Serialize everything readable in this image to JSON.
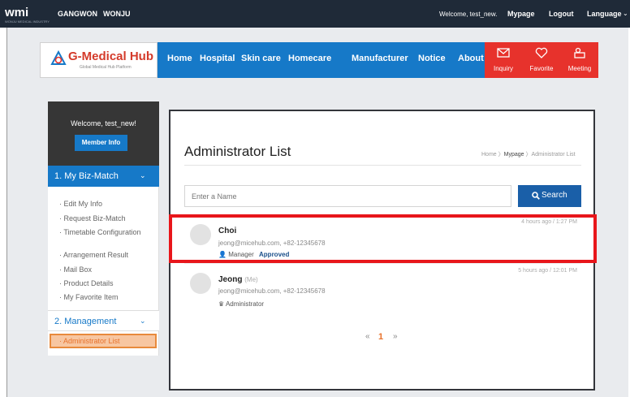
{
  "topbar": {
    "logo": "wmi",
    "logo_sub": "WONJU MEDICAL INDUSTRY",
    "cities": [
      "GANGWON",
      "WONJU"
    ],
    "welcome": "Welcome, test_new.",
    "links": [
      "Mypage",
      "Logout",
      "Language"
    ]
  },
  "header": {
    "brand": "G-Medical Hub",
    "brand_sub": "Global Medical Hub Platform",
    "nav": [
      "Home",
      "Hospital",
      "Skin care",
      "Homecare",
      "Manufacturer",
      "Notice",
      "About"
    ],
    "actions": [
      {
        "label": "Inquiry",
        "icon": "mail-icon"
      },
      {
        "label": "Favorite",
        "icon": "heart-icon"
      },
      {
        "label": "Meeting",
        "icon": "meeting-icon"
      }
    ]
  },
  "sidebar": {
    "welcome": "Welcome, test_new!",
    "member_button": "Member Info",
    "section1": "1. My Biz-Match",
    "section1_links": [
      "· Edit My Info",
      "· Request Biz-Match",
      "· Timetable Configuration",
      "· Arrangement Result",
      "· Mail Box",
      "· Product Details",
      "· My Favorite Item"
    ],
    "section2": "2. Management",
    "section2_active": "· Administrator List"
  },
  "main": {
    "title": "Administrator List",
    "breadcrumb": {
      "home": "Home",
      "sep": " 〉",
      "mypage": "Mypage",
      "current": "Administrator List"
    },
    "search": {
      "placeholder": "Enter a Name",
      "button": "Search"
    },
    "items": [
      {
        "name": "Choi",
        "me": "",
        "contact": "jeong@micehub.com, +82-12345678",
        "role": "Manager",
        "status": "Approved",
        "time": "4 hours ago / 1:27 PM"
      },
      {
        "name": "Jeong",
        "me": "(Me)",
        "contact": "jeong@micehub.com, +82-12345678",
        "role": "Administrator",
        "status": "",
        "time": "5 hours ago / 12:01 PM"
      }
    ],
    "pagination": {
      "prev": "«",
      "current": "1",
      "next": "»"
    }
  },
  "colors": {
    "primary": "#1679c8",
    "red": "#e7322c",
    "highlight": "#e8161b",
    "accent": "#e8712a",
    "dark": "#1f2a38"
  }
}
